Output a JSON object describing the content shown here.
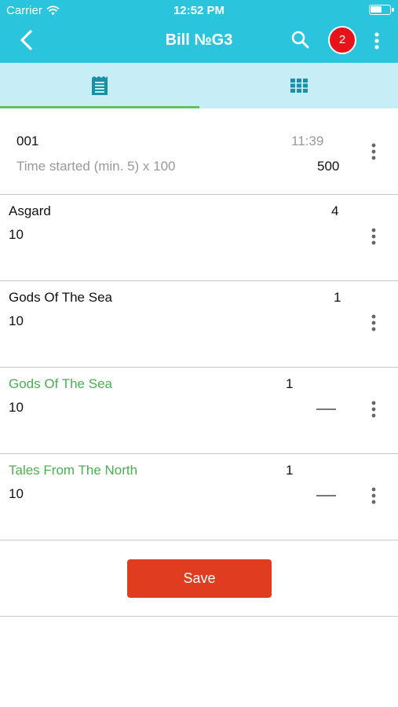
{
  "status_bar": {
    "carrier": "Carrier",
    "time": "12:52 PM"
  },
  "nav": {
    "title": "Bill №G3",
    "badge_count": "2",
    "icons": [
      "back-chevron-icon",
      "search-icon",
      "more-vertical-icon"
    ]
  },
  "tabs": {
    "items": [
      {
        "icon": "receipt-list-icon",
        "active": true
      },
      {
        "icon": "grid-icon",
        "active": false
      }
    ]
  },
  "items": [
    {
      "code": "001",
      "time": "11:39",
      "description": "Time started (min. 5) x 100",
      "amount": "500"
    },
    {
      "name": "Asgard",
      "qty": "4",
      "value": "10"
    },
    {
      "name": "Gods Of The Sea",
      "qty": "1",
      "value": "10"
    },
    {
      "name": "Gods Of The Sea",
      "qty": "1",
      "value": "10",
      "pending": true
    },
    {
      "name": "Tales From The North",
      "qty": "1",
      "value": "10",
      "pending": true
    }
  ],
  "footer": {
    "save_label": "Save"
  },
  "colors": {
    "header": "#2bc4dd",
    "tab_bar": "#c7eef6",
    "tab_indicator": "#5ec16a",
    "pending_text": "#4caf50",
    "badge": "#e8131a",
    "save_button": "#e03c1f"
  }
}
